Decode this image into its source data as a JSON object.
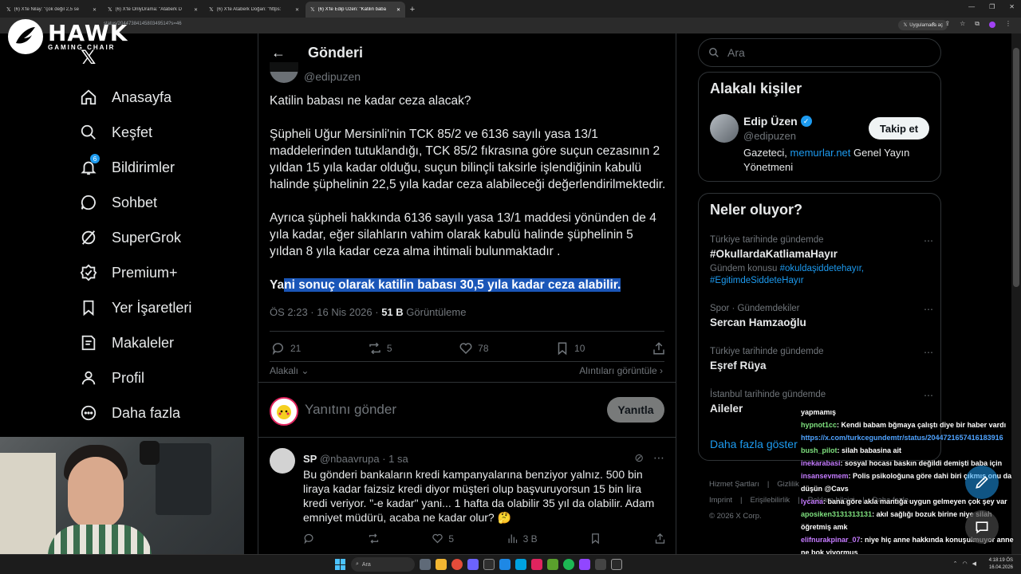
{
  "browser": {
    "tabs": [
      {
        "label": "(6) X'te Nilay: \"çok değil 2,5 se",
        "active": false
      },
      {
        "label": "(6) X'te OnlyDrama: \"Ataberk D",
        "active": false
      },
      {
        "label": "(6) X'te Ataberk Doğan: \"https:",
        "active": false
      },
      {
        "label": "(6) X'te Edip Üzen: \"Katilin baba",
        "active": true
      }
    ],
    "url": "status/2044738414580349514?s=46",
    "app_chip": "Uygulamada aç"
  },
  "overlay": {
    "brand": "HAWK",
    "brand_sub": "GAMING CHAIR"
  },
  "nav": {
    "items": [
      {
        "label": "Anasayfa",
        "icon": "home-icon"
      },
      {
        "label": "Keşfet",
        "icon": "search-icon"
      },
      {
        "label": "Bildirimler",
        "icon": "bell-icon",
        "badge": "6"
      },
      {
        "label": "Sohbet",
        "icon": "chat-icon"
      },
      {
        "label": "SuperGrok",
        "icon": "grok-icon"
      },
      {
        "label": "Premium+",
        "icon": "premium-icon"
      },
      {
        "label": "Yer İşaretleri",
        "icon": "bookmark-icon"
      },
      {
        "label": "Makaleler",
        "icon": "article-icon"
      },
      {
        "label": "Profil",
        "icon": "person-icon"
      },
      {
        "label": "Daha fazla",
        "icon": "more-icon"
      }
    ]
  },
  "post": {
    "header": "Gönderi",
    "handle": "@edipuzen",
    "paragraphs": [
      "Katilin babası ne kadar ceza alacak?",
      "Şüpheli Uğur Mersinli'nin TCK 85/2 ve 6136 sayılı yasa 13/1 maddelerinden tutuklandığı, TCK 85/2 fıkrasına göre suçun cezasının 2 yıldan 15 yıla kadar olduğu, suçun bilinçli taksirle işlendiğinin kabulü halinde şüphelinin 22,5 yıla kadar ceza alabileceği değerlendirilmektedir.",
      "Ayrıca şüpheli hakkında 6136 sayılı yasa 13/1 maddesi yönünden de 4 yıla kadar, eğer silahların vahim olarak kabulü halinde şüphelinin 5 yıldan 8 yıla kadar ceza alma ihtimali bulunmaktadır ."
    ],
    "final_plain": "Ya",
    "final_highlight": "ni sonuç olarak katilin babası 30,5 yıla kadar ceza alabilir.",
    "time": "ÖS 2:23 · 16 Nis 2026 · ",
    "views_count": "51 B",
    "views_label": " Görüntüleme",
    "replies": "21",
    "reposts": "5",
    "likes": "78",
    "bookmarks": "10",
    "relevancy": "Alakalı",
    "quotes_link": "Alıntıları görüntüle",
    "reply_placeholder": "Yanıtını gönder",
    "reply_button": "Yanıtla"
  },
  "comment": {
    "name": "SP",
    "handle": "@nbaavrupa · 1 sa",
    "text": "Bu gönderi bankaların kredi kampanyalarına benziyor yalnız. 500 bin liraya kadar faizsiz kredi diyor müşteri olup başvuruyorsun 15 bin lira kredi veriyor. \"-e kadar\" yani... 1 hafta da olabilir 35 yıl da olabilir. Adam emniyet müdürü, acaba ne kadar olur? 🤔",
    "likes": "5",
    "views": "3 B"
  },
  "sidebar": {
    "search_placeholder": "Ara",
    "related_title": "Alakalı kişiler",
    "person": {
      "name": "Edip Üzen",
      "handle": "@edipuzen",
      "bio_pre": "Gazeteci, ",
      "bio_link": "memurlar.net",
      "bio_post": " Genel Yayın Yönetmeni",
      "follow": "Takip et"
    },
    "trends_title": "Neler oluyor?",
    "trends": [
      {
        "context": "Türkiye tarihinde gündemde",
        "title": "#OkullardaKatliamaHayır",
        "sub_pre": "Gündem konusu ",
        "sub_links": "#okuldaşiddetehayır, #EgitimdeSiddeteHayır"
      },
      {
        "context": "Spor · Gündemdekiler",
        "title": "Sercan Hamzaoğlu"
      },
      {
        "context": "Türkiye tarihinde gündemde",
        "title": "Eşref Rüya"
      },
      {
        "context": "İstanbul tarihinde gündemde",
        "title": "Aileler"
      }
    ],
    "show_more": "Daha fazla göster",
    "footer_line1": [
      "Hizmet Şartları",
      "|",
      "Gizlilik"
    ],
    "footer_line2": [
      "Imprint",
      "|",
      "Erişilebilirlik",
      "|",
      "Reklam bilgisi",
      "|",
      "Daha fazla ..."
    ],
    "copyright": "© 2026 X Corp."
  },
  "chat": [
    {
      "user": "",
      "msg": "yapmamış"
    },
    {
      "user": "hypnot1cc",
      "msg": ": Kendi babam bğmaya çalıştı diye bir haber vardı"
    },
    {
      "user": "",
      "msg": "https://x.com/turkcegundemtr/status/2044721657416183916",
      "link": true
    },
    {
      "user": "bush_pilot",
      "msg": ": silah babasina ait"
    },
    {
      "user": "inekarabasi",
      "msg": ": sosyal hocası baskın değildi demişti baba için"
    },
    {
      "user": "insansevmem",
      "msg": ": Polis psikoloğuna göre dahi biri çıkmış onu da düşün @Cavs"
    },
    {
      "user": "lycana",
      "msg": ": bana göre akla mantığa uygun gelmeyen çok şey var"
    },
    {
      "user": "aposiken3131313131",
      "msg": ": akıl sağlığı bozuk birine niye silah öğretmiş amk"
    },
    {
      "user": "elifnurakpinar_07",
      "msg": ": niye hiç anne hakkında konuşulmuyor anne ne bok yiyormuş"
    }
  ],
  "taskbar": {
    "search": "Ara",
    "time": "4:18:19 ÖS",
    "date": "16.04.2026"
  }
}
